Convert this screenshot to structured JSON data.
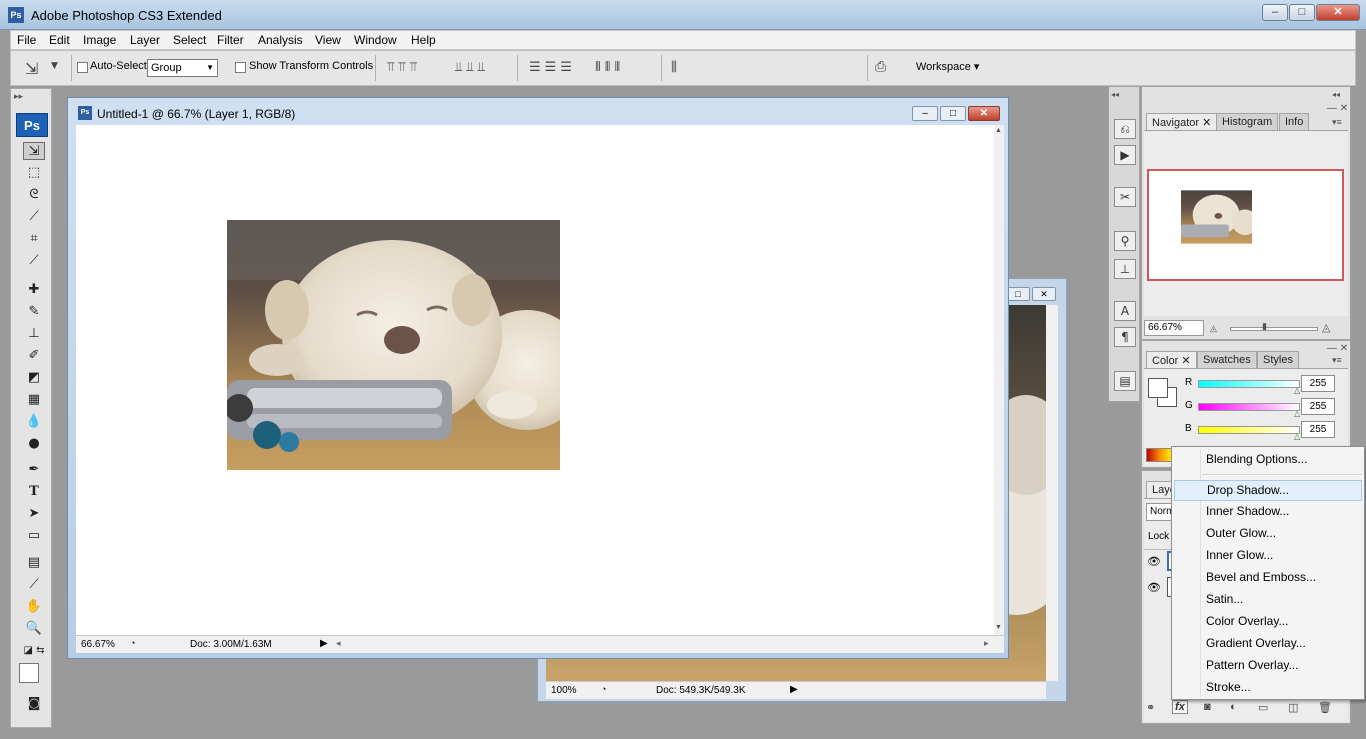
{
  "app": {
    "title": "Adobe Photoshop CS3 Extended",
    "logo": "Ps"
  },
  "window_controls": {
    "minimize": "–",
    "maximize": "□",
    "close": "✕"
  },
  "menu": [
    "File",
    "Edit",
    "Image",
    "Layer",
    "Select",
    "Filter",
    "Analysis",
    "View",
    "Window",
    "Help"
  ],
  "options": {
    "auto_select_label": "Auto-Select:",
    "auto_select_value": "Group",
    "show_transform_label": "Show Transform Controls",
    "workspace_label": "Workspace ▾"
  },
  "tools": {
    "badge": "Ps"
  },
  "doc1": {
    "title": "Untitled-1 @ 66.7% (Layer 1, RGB/8)",
    "zoom": "66.67%",
    "doc_info": "Doc: 3.00M/1.63M"
  },
  "doc2": {
    "zoom": "100%",
    "doc_info": "Doc: 549.3K/549.3K"
  },
  "navigator_panel": {
    "tabs": [
      "Navigator",
      "Histogram",
      "Info"
    ],
    "zoom": "66.67%"
  },
  "color_panel": {
    "tabs": [
      "Color",
      "Swatches",
      "Styles"
    ],
    "channels": [
      {
        "label": "R",
        "value": "255"
      },
      {
        "label": "G",
        "value": "255"
      },
      {
        "label": "B",
        "value": "255"
      }
    ]
  },
  "layers_panel": {
    "tab": "Laye",
    "blend_mode": "Norm",
    "lock_label": "Lock"
  },
  "context_menu": {
    "items": [
      "Blending Options...",
      "Drop Shadow...",
      "Inner Shadow...",
      "Outer Glow...",
      "Inner Glow...",
      "Bevel and Emboss...",
      "Satin...",
      "Color Overlay...",
      "Gradient Overlay...",
      "Pattern Overlay...",
      "Stroke..."
    ],
    "highlighted": "Drop Shadow..."
  }
}
